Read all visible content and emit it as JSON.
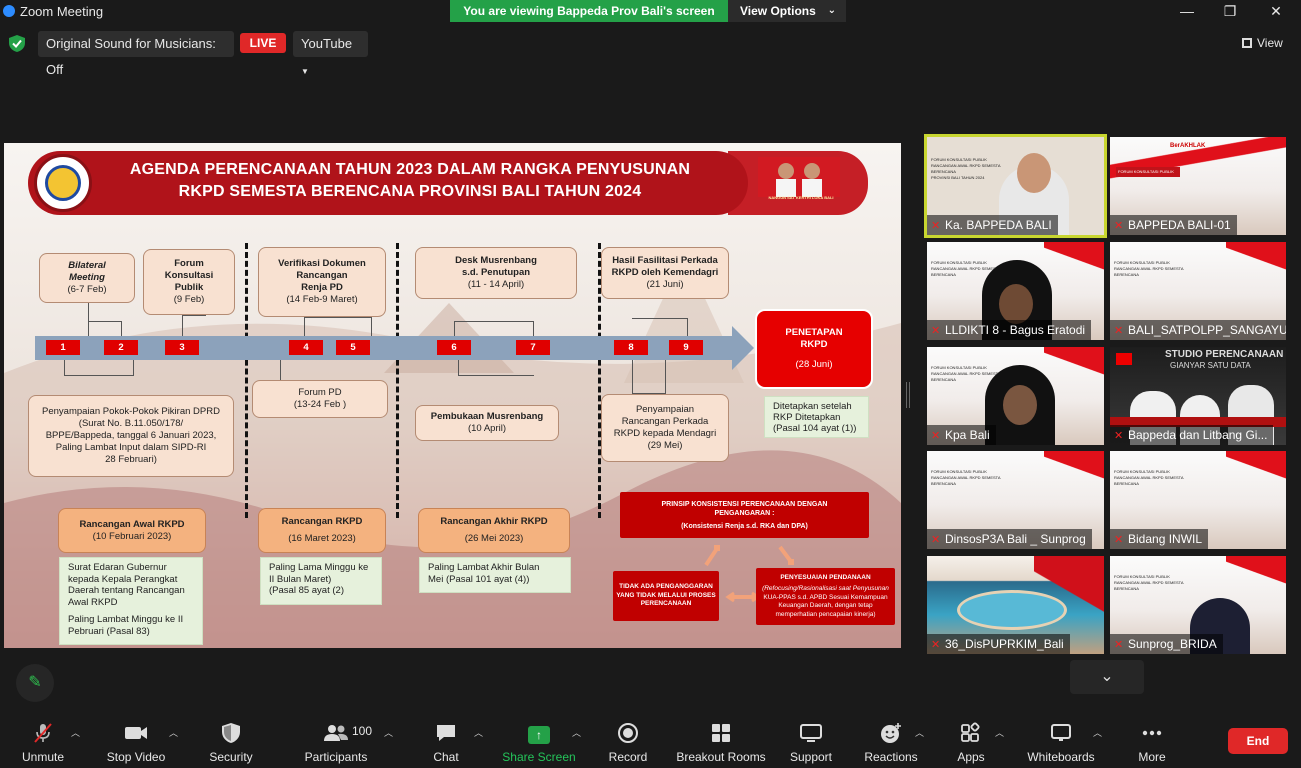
{
  "window": {
    "title": "Zoom Meeting",
    "share_banner": "You are viewing Bappeda Prov Bali's screen",
    "view_options": "View Options",
    "minimize": "—",
    "restore": "❐",
    "close": "✕"
  },
  "topbar": {
    "original_sound": "Original Sound for Musicians: Off",
    "live": "LIVE",
    "stream": "YouTube",
    "view": "View"
  },
  "slide": {
    "title_line1": "AGENDA PERENCANAAN TAHUN 2023 DALAM RANGKA PENYUSUNAN",
    "title_line2": "RKPD SEMESTA BERENCANA PROVINSI BALI TAHUN 2024",
    "header_caption": "NANGUN SAT KERTHI LOKA BALI",
    "top_boxes": [
      {
        "l1": "Bilateral",
        "l2": "Meeting",
        "l3": "(6-7 Feb)"
      },
      {
        "l1": "Forum",
        "l2": "Konsultasi",
        "l3": "Publik",
        "l4": "(9 Feb)"
      },
      {
        "l1": "Verifikasi Dokumen",
        "l2": "Rancangan",
        "l3": "Renja PD",
        "l4": "(14 Feb-9 Maret)"
      },
      {
        "l1": "Desk Musrenbang",
        "l2": "s.d. Penutupan",
        "l3": "(11 - 14 April)"
      },
      {
        "l1": "Hasil Fasilitasi Perkada",
        "l2": "RKPD oleh Kemendagri",
        "l3": "(21 Juni)"
      }
    ],
    "numbers": [
      "1",
      "2",
      "3",
      "4",
      "5",
      "6",
      "7",
      "8",
      "9"
    ],
    "penetapan": {
      "l1": "PENETAPAN",
      "l2": "RKPD",
      "l3": "(28 Juni)"
    },
    "penetapan_note": {
      "l1": "Ditetapkan setelah",
      "l2": "RKP Ditetapkan",
      "l3": "(Pasal 104 ayat (1))"
    },
    "bottom_boxes": [
      {
        "l1": "Penyampaian Pokok-Pokok Pikiran DPRD",
        "l2": "(Surat No. B.11.050/178/",
        "l3": "BPPE/Bappeda, tanggal 6 Januari 2023,",
        "l4": "Paling Lambat Input dalam SIPD-RI",
        "l5": "28 Februari)"
      },
      {
        "l1": "Forum PD",
        "l2": "(13-24 Feb )"
      },
      {
        "l1": "Pembukaan Musrenbang",
        "l2": "(10 April)"
      },
      {
        "l1": "Penyampaian",
        "l2": "Rancangan Perkada",
        "l3": "RKPD kepada Mendagri",
        "l4": "(29 Mei)"
      }
    ],
    "orange_boxes": [
      {
        "l1": "Rancangan Awal RKPD",
        "l2": "(10 Februari 2023)"
      },
      {
        "l1": "Rancangan RKPD",
        "l2": "(16 Maret 2023)"
      },
      {
        "l1": "Rancangan Akhir RKPD",
        "l2": "(26 Mei 2023)"
      }
    ],
    "green_notes": [
      {
        "l1": "Surat Edaran Gubernur",
        "l2": "kepada Kepala Perangkat",
        "l3": "Daerah tentang  Rancangan",
        "l4": "Awal RKPD",
        "l5": "Paling Lambat Minggu ke II",
        "l6": "Pebruari (Pasal 83)"
      },
      {
        "l1": "Paling Lama Minggu ke",
        "l2": "II Bulan Maret)",
        "l3": "(Pasal 85 ayat (2)"
      },
      {
        "l1": "Paling Lambat Akhir Bulan",
        "l2": "Mei (Pasal 101 ayat (4))"
      }
    ],
    "prinsip": {
      "l1": "PRINSIP KONSISTENSI PERENCANAAN DENGAN",
      "l2": "PENGANGARAN :",
      "l3": "(Konsistensi Renja s.d. RKA dan DPA)"
    },
    "tidak_ada": {
      "l1": "TIDAK ADA PENGANGGARAN",
      "l2": "YANG TIDAK MELALUI PROSES",
      "l3": "PERENCANAAN"
    },
    "penyesuaian": {
      "l1": "PENYESUAIAN PENDANAAN",
      "l2": "(Refocusing/Rasionalisasi saat Penyusunan",
      "l3": "KUA-PPAS s.d. APBD Sesuai Kemampuan",
      "l4": "Keuangan Daerah, dengan tetap",
      "l5": "memperhatian pencapaian kinerja)"
    }
  },
  "participants": [
    {
      "name": "Ka. BAPPEDA BALI"
    },
    {
      "name": "BAPPEDA BALI-01"
    },
    {
      "name": "LLDIKTI 8 - Bagus Eratodi"
    },
    {
      "name": "BALI_SATPOLPP_SANGAYU"
    },
    {
      "name": "Kpa Bali"
    },
    {
      "name": "Bappeda dan Litbang Gi..."
    },
    {
      "name": "DinsosP3A Bali _ Sunprog"
    },
    {
      "name": "Bidang INWIL"
    },
    {
      "name": "36_DisPUPRKIM_Bali"
    },
    {
      "name": "Sunprog_BRIDA"
    }
  ],
  "tile_texts": {
    "forum": "FORUM KONSULTASI PUBLIK",
    "rancangan": "RANCANGAN AWAL RKPD SEMESTA BERENCANA",
    "provinsi": "PROVINSI BALI TAHUN 2024",
    "studio": "STUDIO PERENCANAAN",
    "studio2": "GIANYAR SATU DATA",
    "berakhlak": "BerAKHLAK"
  },
  "toolbar": {
    "unmute": "Unmute",
    "stop_video": "Stop Video",
    "security": "Security",
    "participants": "Participants",
    "participants_count": "100",
    "chat": "Chat",
    "share_screen": "Share Screen",
    "record": "Record",
    "breakout": "Breakout Rooms",
    "support": "Support",
    "reactions": "Reactions",
    "apps": "Apps",
    "whiteboards": "Whiteboards",
    "more": "More",
    "end": "End"
  }
}
